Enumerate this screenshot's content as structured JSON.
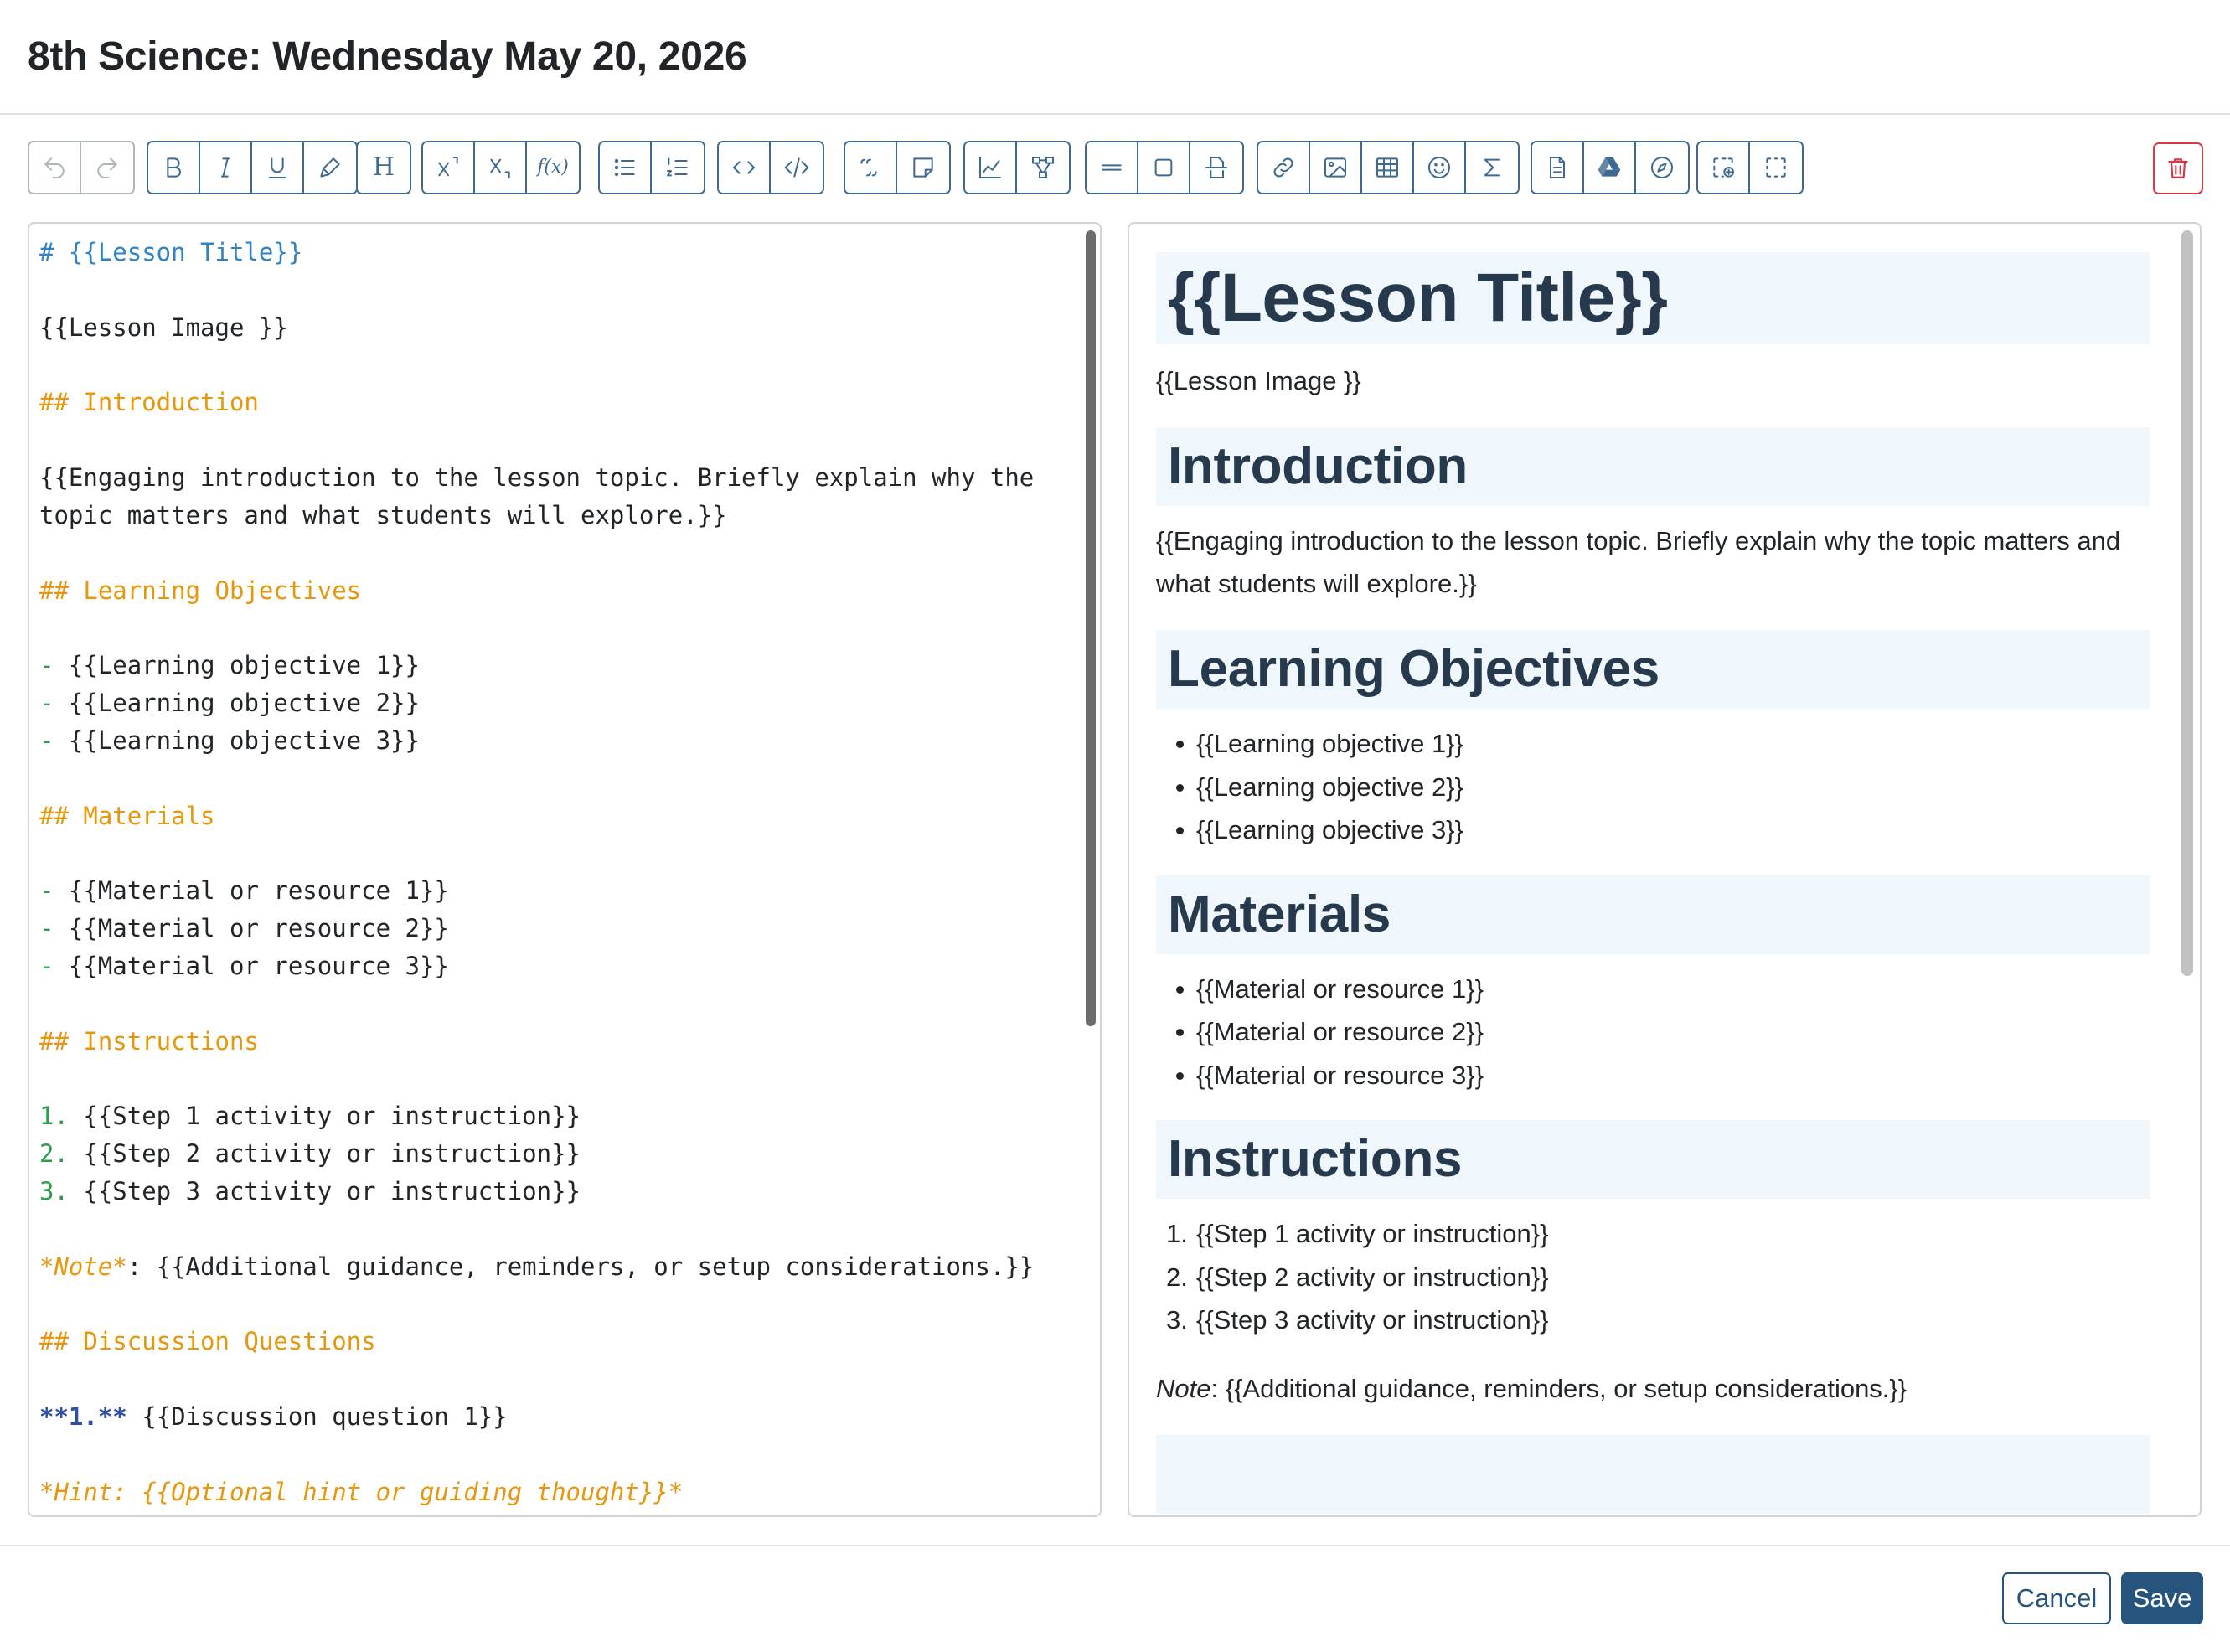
{
  "header": {
    "title": "8th Science: Wednesday May 20, 2026"
  },
  "toolbar": {
    "groups": [
      [
        "undo",
        "redo"
      ],
      [
        "bold",
        "italic",
        "underline",
        "highlight"
      ],
      [
        "heading"
      ],
      [
        "superscript",
        "subscript",
        "function"
      ],
      [
        "bullet-list",
        "numbered-list"
      ],
      [
        "code",
        "code-block"
      ],
      [
        "quote",
        "sticky-note"
      ],
      [
        "chart",
        "diagram"
      ],
      [
        "horizontal-rule",
        "box",
        "page-break"
      ],
      [
        "link",
        "image",
        "table",
        "emoji",
        "sigma"
      ],
      [
        "document",
        "google-drive",
        "compass"
      ],
      [
        "add-region",
        "select-region"
      ]
    ],
    "labels": {
      "heading": "H",
      "function": "f(x)"
    }
  },
  "editor": {
    "lines": [
      "# {{Lesson Title}}",
      "",
      "{{Lesson Image }}",
      "",
      "## Introduction",
      "",
      "{{Engaging introduction to the lesson topic. Briefly explain why the",
      "topic matters and what students will explore.}}",
      "",
      "## Learning Objectives",
      "",
      "- {{Learning objective 1}}",
      "- {{Learning objective 2}}",
      "- {{Learning objective 3}}",
      "",
      "## Materials",
      "",
      "- {{Material or resource 1}}",
      "- {{Material or resource 2}}",
      "- {{Material or resource 3}}",
      "",
      "## Instructions",
      "",
      "1. {{Step 1 activity or instruction}}",
      "2. {{Step 2 activity or instruction}}",
      "3. {{Step 3 activity or instruction}}",
      "",
      "*Note*: {{Additional guidance, reminders, or setup considerations.}}",
      "",
      "## Discussion Questions",
      "",
      "**1.** {{Discussion question 1}}",
      "",
      "*Hint: {{Optional hint or guiding thought}}*"
    ]
  },
  "preview": {
    "h1": "{{Lesson Title}}",
    "image_placeholder": "{{Lesson Image }}",
    "intro_heading": "Introduction",
    "intro_text": "{{Engaging introduction to the lesson topic. Briefly explain why the topic matters and what students will explore.}}",
    "objectives_heading": "Learning Objectives",
    "objectives": [
      "{{Learning objective 1}}",
      "{{Learning objective 2}}",
      "{{Learning objective 3}}"
    ],
    "materials_heading": "Materials",
    "materials": [
      "{{Material or resource 1}}",
      "{{Material or resource 2}}",
      "{{Material or resource 3}}"
    ],
    "instructions_heading": "Instructions",
    "instructions": [
      "{{Step 1 activity or instruction}}",
      "{{Step 2 activity or instruction}}",
      "{{Step 3 activity or instruction}}"
    ],
    "note_label": "Note",
    "note_text": ": {{Additional guidance, reminders, or setup considerations.}}"
  },
  "footer": {
    "cancel_label": "Cancel",
    "save_label": "Save"
  },
  "colors": {
    "accent": "#26547c",
    "danger": "#dc3545",
    "heading_bg": "#eff6fc",
    "md_h1": "#2f82c4",
    "md_h2": "#e8960c",
    "md_list_marker": "#2e9d4a",
    "md_strong": "#2d4fa5"
  }
}
